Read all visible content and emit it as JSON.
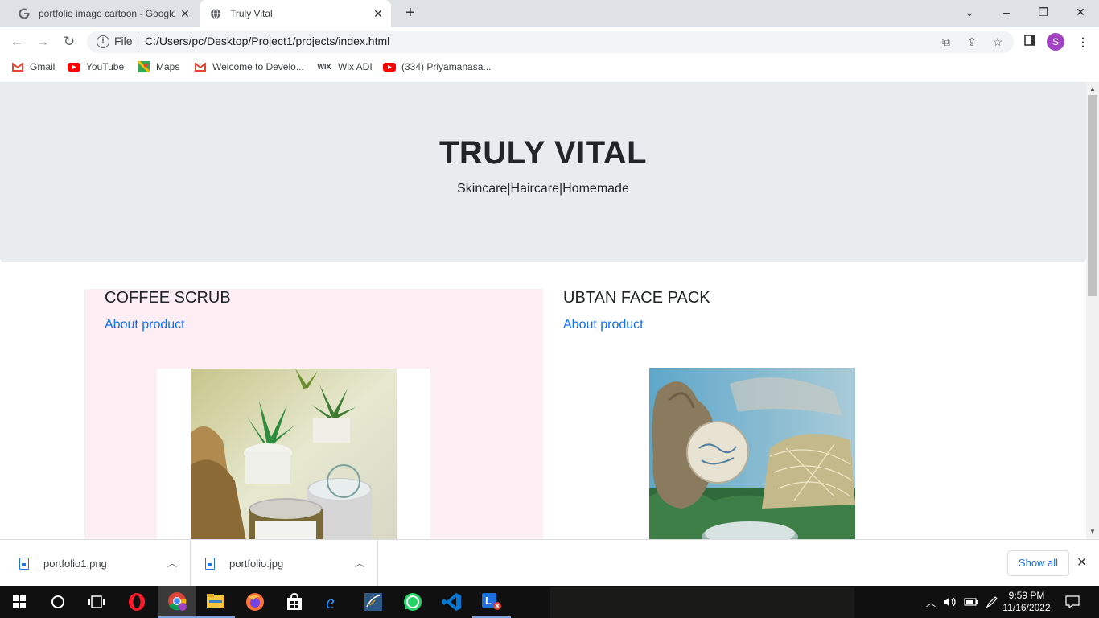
{
  "browser": {
    "tabs": [
      {
        "title": "portfolio image cartoon - Google",
        "icon": "google-icon"
      },
      {
        "title": "Truly Vital",
        "icon": "globe-icon"
      }
    ],
    "new_tab_symbol": "+",
    "window_controls": {
      "minimize": "–",
      "restore": "❐",
      "close": "✕",
      "tab_list": "⌄"
    },
    "address": {
      "scheme_label": "File",
      "url": "C:/Users/pc/Desktop/Project1/projects/index.html"
    },
    "profile_initial": "S",
    "bookmarks": [
      {
        "label": "Gmail",
        "icon": "gmail-icon",
        "color": "#ea4335"
      },
      {
        "label": "YouTube",
        "icon": "youtube-icon",
        "color": "#ff0000"
      },
      {
        "label": "Maps",
        "icon": "maps-icon",
        "color": "#34a853"
      },
      {
        "label": "Welcome to Develo...",
        "icon": "gmail-icon",
        "color": "#ea4335"
      },
      {
        "label": "Wix ADI",
        "icon": "wix-icon",
        "color": "#000000"
      },
      {
        "label": "(334) Priyamanasa...",
        "icon": "youtube-icon",
        "color": "#ff0000"
      }
    ]
  },
  "page": {
    "hero": {
      "title": "TRULY VITAL",
      "subtitle": "Skincare|Haircare|Homemade"
    },
    "products": [
      {
        "name": "COFFEE SCRUB",
        "link": "About product",
        "image": "coffee-scrub-photo"
      },
      {
        "name": "UBTAN FACE PACK",
        "link": "About product",
        "image": "ubtan-face-pack-photo"
      }
    ]
  },
  "downloads": {
    "items": [
      {
        "filename": "portfolio1.png"
      },
      {
        "filename": "portfolio.jpg"
      }
    ],
    "show_all": "Show all",
    "close": "✕"
  },
  "taskbar": {
    "clock_time": "9:59 PM",
    "clock_date": "11/16/2022",
    "apps": [
      "start-icon",
      "search-icon",
      "task-view-icon",
      "opera-icon",
      "chrome-icon",
      "file-explorer-icon",
      "firefox-icon",
      "store-icon",
      "edge-icon",
      "mysql-icon",
      "whatsapp-icon",
      "vscode-icon",
      "app-l-icon"
    ]
  },
  "colors": {
    "accent": "#0d6efd",
    "hero_bg": "#e9ecef",
    "card_bg": "#fdeef3"
  }
}
